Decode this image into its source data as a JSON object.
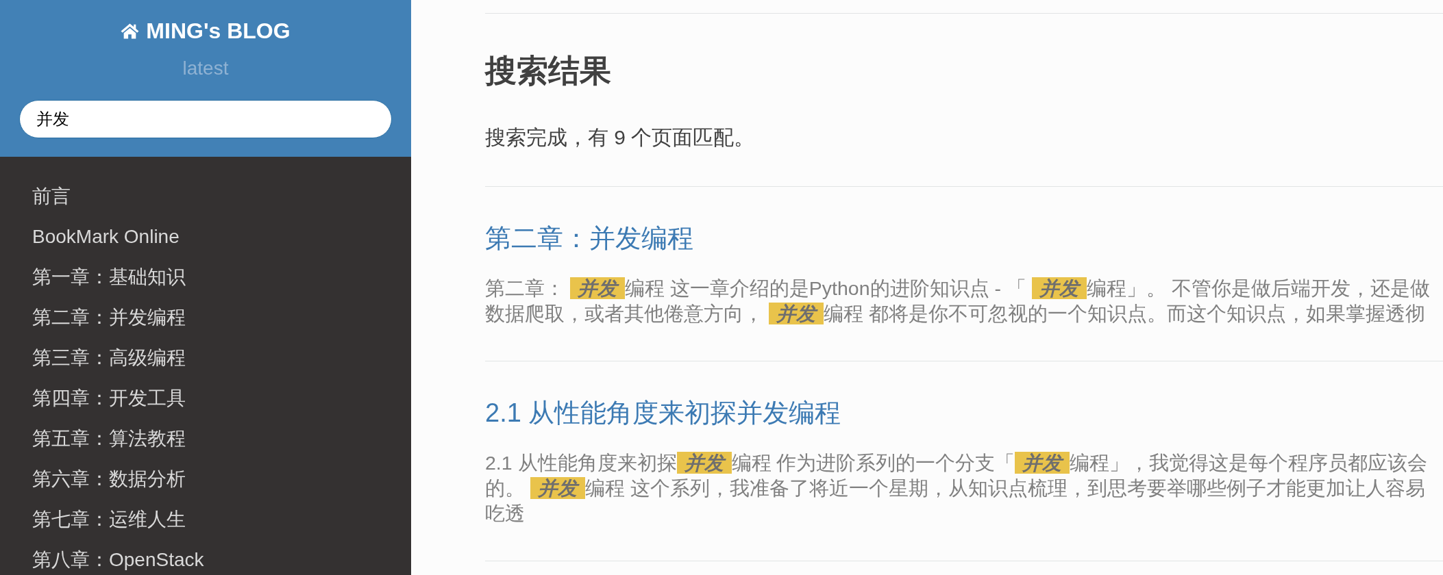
{
  "sidebar": {
    "title": "MING's BLOG",
    "version": "latest",
    "search": {
      "value": "并发"
    },
    "items": [
      {
        "label": "前言"
      },
      {
        "label": "BookMark Online"
      },
      {
        "label": "第一章：基础知识"
      },
      {
        "label": "第二章：并发编程"
      },
      {
        "label": "第三章：高级编程"
      },
      {
        "label": "第四章：开发工具"
      },
      {
        "label": "第五章：算法教程"
      },
      {
        "label": "第六章：数据分析"
      },
      {
        "label": "第七章：运维人生"
      },
      {
        "label": "第八章：OpenStack"
      }
    ]
  },
  "main": {
    "heading": "搜索结果",
    "summary": "搜索完成，有 9 个页面匹配。",
    "results": [
      {
        "title": "第二章：并发编程",
        "snippet": [
          {
            "text": "第二章： ",
            "highlighted": false
          },
          {
            "text": "并发",
            "highlighted": true
          },
          {
            "text": "编程 这一章介绍的是Python的进阶知识点 - 「 ",
            "highlighted": false
          },
          {
            "text": "并发",
            "highlighted": true
          },
          {
            "text": "编程」。 不管你是做后端开发，还是做数据爬取，或者其他倦意方向， ",
            "highlighted": false
          },
          {
            "text": "并发",
            "highlighted": true
          },
          {
            "text": "编程 都将是你不可忽视的一个知识点。而这个知识点，如果掌握透彻",
            "highlighted": false
          }
        ]
      },
      {
        "title": "2.1 从性能角度来初探并发编程",
        "snippet": [
          {
            "text": "2.1 从性能角度来初探",
            "highlighted": false
          },
          {
            "text": "并发",
            "highlighted": true
          },
          {
            "text": "编程 作为进阶系列的一个分支「",
            "highlighted": false
          },
          {
            "text": "并发",
            "highlighted": true
          },
          {
            "text": "编程」，我觉得这是每个程序员都应该会的。 ",
            "highlighted": false
          },
          {
            "text": "并发",
            "highlighted": true
          },
          {
            "text": "编程 这个系列，我准备了将近一个星期，从知识点梳理，到思考要举哪些例子才能更加让人容易吃透",
            "highlighted": false
          }
        ]
      }
    ]
  }
}
